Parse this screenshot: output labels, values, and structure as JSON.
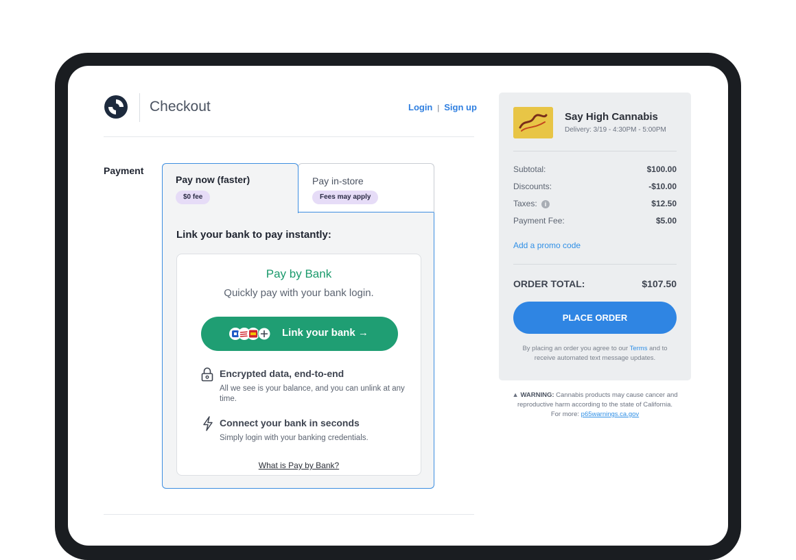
{
  "header": {
    "title": "Checkout",
    "login": "Login",
    "separator": "|",
    "signup": "Sign up"
  },
  "payment": {
    "label": "Payment",
    "tabs": [
      {
        "title": "Pay now (faster)",
        "badge": "$0 fee",
        "active": true
      },
      {
        "title": "Pay in-store",
        "badge": "Fees may apply",
        "active": false
      }
    ],
    "heading": "Link your bank to pay instantly:",
    "card": {
      "title": "Pay by Bank",
      "subtitle": "Quickly pay with your bank login.",
      "button": "Link your bank →",
      "features": [
        {
          "icon": "lock-icon",
          "title": "Encrypted data, end-to-end",
          "desc": "All we see is your balance, and you can unlink at any time."
        },
        {
          "icon": "lightning-icon",
          "title": "Connect your bank in seconds",
          "desc": "Simply login with your banking credentials."
        }
      ],
      "link": "What is Pay by Bank?"
    }
  },
  "summary": {
    "store_name": "Say High Cannabis",
    "delivery": "Delivery: 3/19 - 4:30PM - 5:00PM",
    "rows": [
      {
        "label": "Subtotal:",
        "value": "$100.00"
      },
      {
        "label": "Discounts:",
        "value": "-$10.00"
      },
      {
        "label": "Taxes:",
        "value": "$12.50",
        "info": "i"
      },
      {
        "label": "Payment Fee:",
        "value": "$5.00"
      }
    ],
    "promo": "Add a promo code",
    "total_label": "ORDER TOTAL:",
    "total_value": "$107.50",
    "place_order": "PLACE ORDER",
    "agree_before": "By placing an order you agree to our ",
    "terms": "Terms",
    "agree_after": " and to receive automated text message updates."
  },
  "warning": {
    "icon": "▲",
    "label": "WARNING:",
    "text": " Cannabis products may cause cancer and reproductive harm according to the state of California.",
    "more": "For more: ",
    "link": "p65warnings.ca.gov"
  },
  "colors": {
    "accent_blue": "#2f85e3",
    "bank_green": "#1f9e73",
    "badge_purple": "#e6dcf7",
    "device_frame": "#1a1d21"
  }
}
